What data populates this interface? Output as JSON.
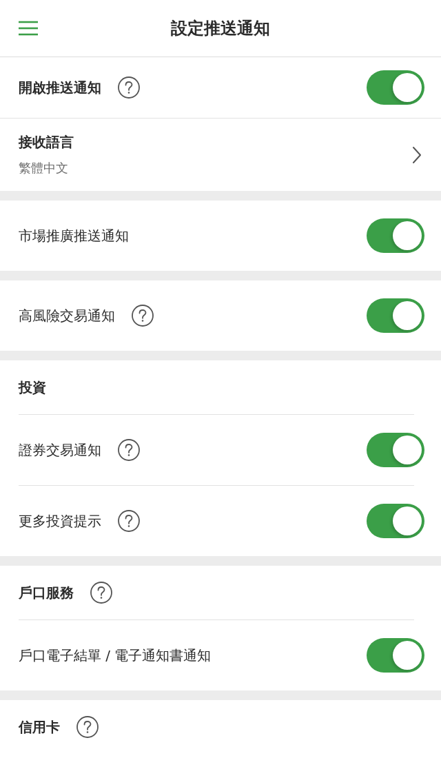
{
  "header": {
    "title": "設定推送通知"
  },
  "sections": [
    {
      "rows": [
        {
          "kind": "master",
          "label": "開啟推送通知",
          "help": true,
          "on": true
        },
        {
          "kind": "picker",
          "label": "接收語言",
          "value": "繁體中文"
        }
      ]
    },
    {
      "rows": [
        {
          "kind": "switch",
          "label": "市場推廣推送通知",
          "help": false,
          "on": true
        }
      ]
    },
    {
      "rows": [
        {
          "kind": "switch",
          "label": "高風險交易通知",
          "help": true,
          "on": true
        }
      ]
    },
    {
      "heading": {
        "label": "投資",
        "help": false
      },
      "rows": [
        {
          "kind": "switch",
          "label": "證券交易通知",
          "help": true,
          "on": true
        },
        {
          "kind": "switch",
          "label": "更多投資提示",
          "help": true,
          "on": true
        }
      ]
    },
    {
      "heading": {
        "label": "戶口服務",
        "help": true
      },
      "rows": [
        {
          "kind": "switch",
          "label": "戶口電子結單 / 電子通知書通知",
          "help": false,
          "on": true
        }
      ]
    },
    {
      "heading": {
        "label": "信用卡",
        "help": true
      }
    }
  ]
}
